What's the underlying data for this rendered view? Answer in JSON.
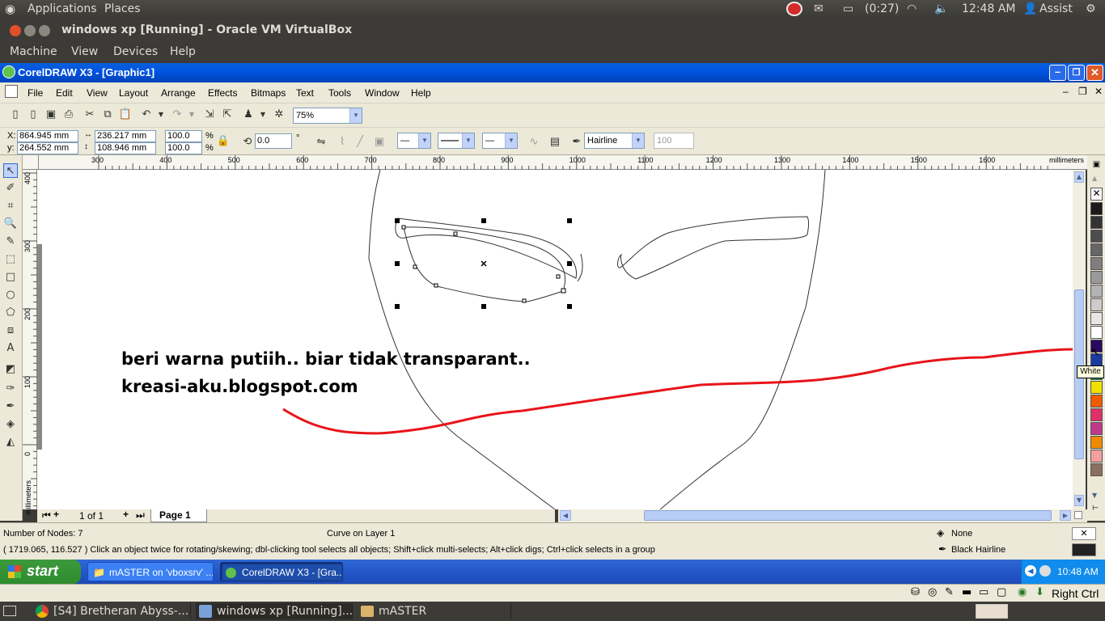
{
  "ubuntu_panel": {
    "applications": "Applications",
    "places": "Places",
    "battery": "(0:27)",
    "clock": "12:48 AM",
    "user": "Assist"
  },
  "vbox": {
    "title": "windows xp [Running] - Oracle VM VirtualBox",
    "menu": [
      "Machine",
      "View",
      "Devices",
      "Help"
    ],
    "host_key": "Right Ctrl"
  },
  "coreldraw": {
    "title": "CorelDRAW X3 - [Graphic1]",
    "menu": [
      "File",
      "Edit",
      "View",
      "Layout",
      "Arrange",
      "Effects",
      "Bitmaps",
      "Text",
      "Tools",
      "Window",
      "Help"
    ],
    "zoom": "75%",
    "x_label": "X:",
    "x_value": "864.945 mm",
    "y_label": "y:",
    "y_value": "264.552 mm",
    "width_value": "236.217 mm",
    "height_value": "108.946 mm",
    "scale_x": "100.0",
    "scale_y": "100.0",
    "percent": "%",
    "rotation": "0.0",
    "degree": "°",
    "outline_width": "Hairline",
    "outline_scale": "100",
    "ruler_unit": "millimeters",
    "ruler_top_ticks": [
      "300",
      "400",
      "500",
      "600",
      "700",
      "800",
      "900",
      "1000",
      "1100",
      "1200",
      "1300",
      "1400",
      "1500",
      "1600"
    ],
    "ruler_left_ticks": [
      "400",
      "300",
      "200",
      "100",
      "0"
    ],
    "annotation_line1": "beri warna putiih.. biar tidak transparant..",
    "annotation_line2": "kreasi-aku.blogspot.com",
    "tooltip": "White",
    "page_counter": "1 of 1",
    "page_tab": "Page 1",
    "status_nodes": "Number of Nodes: 7",
    "status_layer": "Curve on Layer 1",
    "status_fill": "None",
    "status_outline": "Black  Hairline",
    "status_hint": "( 1719.065, 116.527 )   Click an object twice for rotating/skewing; dbl-clicking tool selects all objects; Shift+click multi-selects; Alt+click digs; Ctrl+click selects in a group",
    "palette_colors": [
      "#1a1a1a",
      "#333333",
      "#4d4d4d",
      "#666666",
      "#7f7f7f",
      "#999999",
      "#b3b3b3",
      "#cccccc",
      "#e6e6e6",
      "#ffffff",
      "#2a0a5e",
      "#1a3aa0",
      "#1a9a4a",
      "#f0e000",
      "#f05a00",
      "#e0306a",
      "#c03a8a",
      "#f08a00",
      "#f4a0a0",
      "#8a7060"
    ]
  },
  "xp_taskbar": {
    "start": "start",
    "buttons": [
      "mASTER on 'vboxsrv' ...",
      "CorelDRAW X3 - [Gra..."
    ],
    "clock": "10:48 AM"
  },
  "ubuntu_bottom": {
    "tasks": [
      "[S4] Bretheran Abyss-...",
      "windows xp [Running]...",
      "mASTER"
    ]
  }
}
